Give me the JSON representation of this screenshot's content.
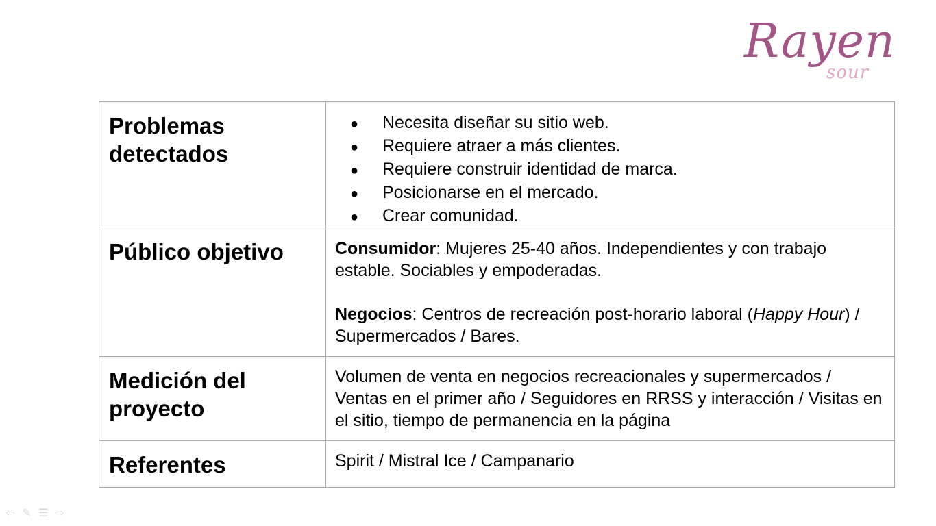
{
  "logo": {
    "main": "Rayen",
    "sub": "sour"
  },
  "rows": [
    {
      "label": "Problemas detectados",
      "bullets": [
        "Necesita diseñar su sitio web.",
        "Requiere atraer a más clientes.",
        "Requiere construir identidad de marca.",
        "Posicionarse en el mercado.",
        "Crear comunidad."
      ]
    },
    {
      "label": "Público objetivo",
      "consumidor_label": "Consumidor",
      "consumidor_text": ": Mujeres 25-40 años. Independientes y con trabajo estable. Sociables y empoderadas.",
      "negocios_label": "Negocios",
      "negocios_text_1": ": Centros de recreación post-horario laboral (",
      "negocios_italic": "Happy Hour",
      "negocios_text_2": ") / Supermercados / Bares."
    },
    {
      "label": "Medición del proyecto",
      "text": "Volumen de venta en negocios recreacionales y supermercados / Ventas en el primer año / Seguidores en RRSS y interacción / Visitas en el sitio, tiempo de permanencia en la página"
    },
    {
      "label": "Referentes",
      "text": "Spirit / Mistral Ice / Campanario"
    }
  ],
  "nav": {
    "prev_icon": "arrow-left-icon",
    "pen_icon": "pen-icon",
    "menu_icon": "menu-icon",
    "next_icon": "arrow-right-icon",
    "prev_glyph": "⇦",
    "pen_glyph": "✎",
    "menu_glyph": "☰",
    "next_glyph": "⇨"
  },
  "colors": {
    "logo_main": "#a35585",
    "logo_sub": "#e0a8c8",
    "border": "#a6a6a6"
  }
}
